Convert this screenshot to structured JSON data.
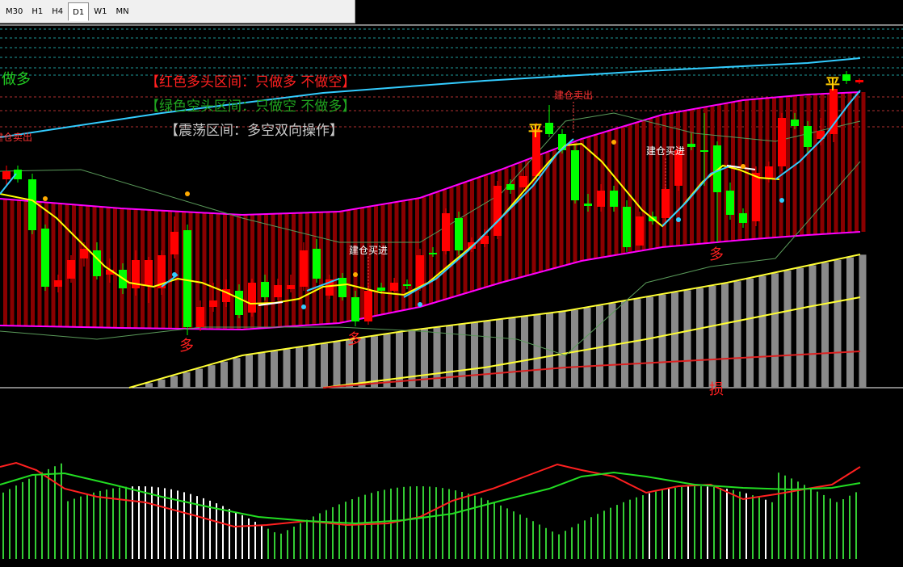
{
  "timeframes": {
    "items": [
      "M30",
      "H1",
      "H4",
      "D1",
      "W1",
      "MN"
    ],
    "active": "D1"
  },
  "main_chart": {
    "legend": {
      "red_zone": "【红色多头区间：只做多 不做空】",
      "green_zone": "【绿色空头区间：只做空 不做多】",
      "range_zone": "【震荡区间：多空双向操作】"
    },
    "trend_label": "做多",
    "signals": {
      "close": "平",
      "long_entry": "建仓买进",
      "short_entry": "建仓卖出",
      "long_mark": "多",
      "stop_mark": "损"
    },
    "colors": {
      "bull_candle": "#ff0000",
      "bear_candle": "#00ff00",
      "channel_band": "#ff00ff",
      "trend_line": "#33ccff",
      "support_lines": "#ffff33",
      "fast_ma": "#ffff00",
      "background": "#000000"
    }
  },
  "sub_chart": {
    "colors": {
      "fast_line": "#ff2020",
      "slow_line": "#22dd22",
      "histogram_up": "#33cc33",
      "histogram_down": "#ffffff"
    }
  }
}
